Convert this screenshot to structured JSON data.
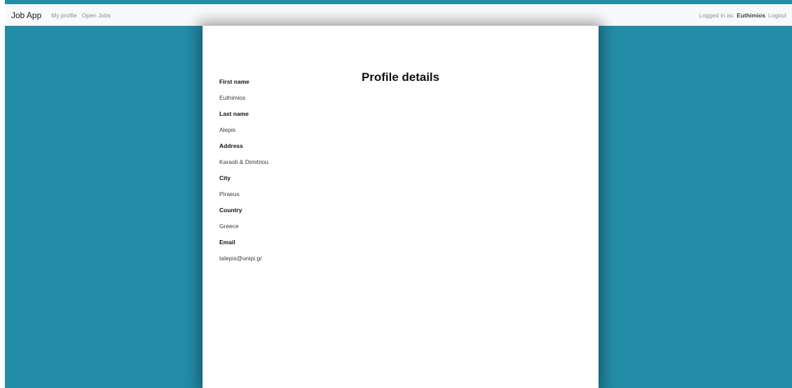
{
  "navbar": {
    "brand": "Job App",
    "links": [
      {
        "label": "My profile"
      },
      {
        "label": "Open Jobs"
      }
    ],
    "logged_in_prefix": "Logged in as:",
    "user_name": "Euthimios",
    "logout_label": "Logout"
  },
  "profile": {
    "title": "Profile details",
    "fields": [
      {
        "label": "First name",
        "value": "Euthimios"
      },
      {
        "label": "Last name",
        "value": "Alepis"
      },
      {
        "label": "Address",
        "value": "Karaoli & Dimitriou"
      },
      {
        "label": "City",
        "value": "Piraeus"
      },
      {
        "label": "Country",
        "value": "Greece"
      },
      {
        "label": "Email",
        "value": "talepis@unipi.gr"
      }
    ]
  },
  "colors": {
    "background_accent": "#238ca6",
    "navbar_bg": "#f8f9fa"
  }
}
